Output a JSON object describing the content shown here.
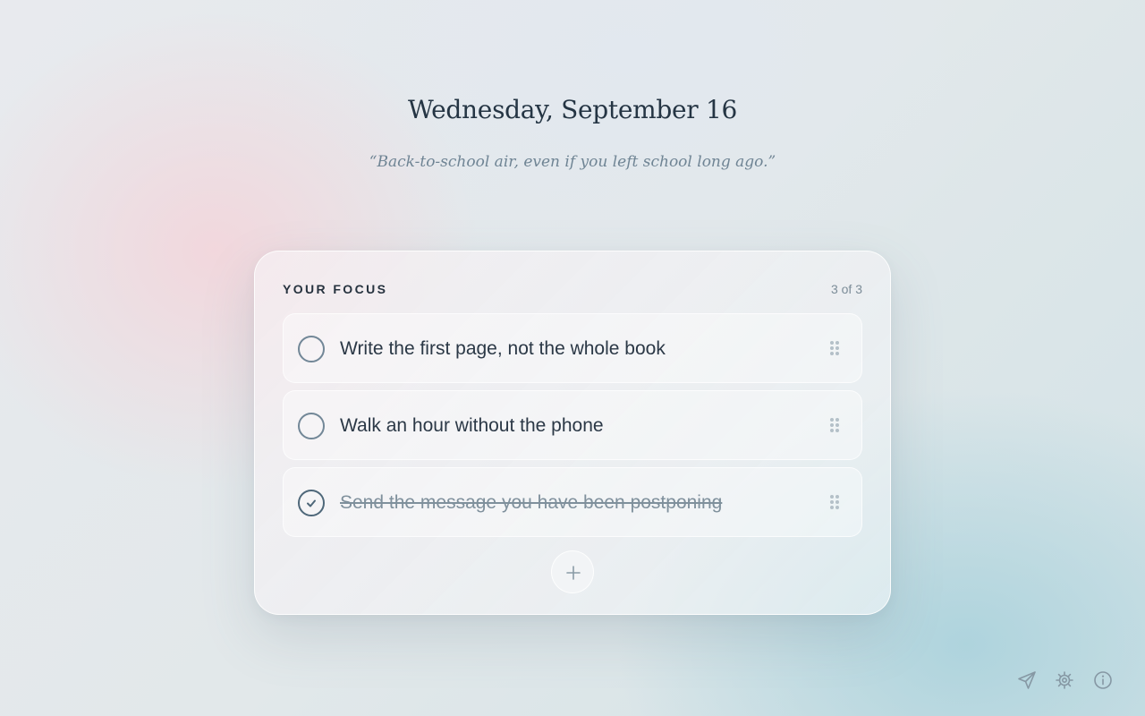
{
  "header": {
    "date": "Wednesday, September 16",
    "quote": "“Back-to-school air, even if you left school long ago.”"
  },
  "focus": {
    "title": "YOUR FOCUS",
    "count": "3 of 3",
    "tasks": [
      {
        "text": "Write the first page, not the whole book",
        "done": false
      },
      {
        "text": "Walk an hour without the phone",
        "done": false
      },
      {
        "text": "Send the message you have been postponing",
        "done": true
      }
    ],
    "add_icon": "plus-icon"
  },
  "toolbar": {
    "icons": [
      "send-icon",
      "gear-icon",
      "info-icon"
    ]
  },
  "colors": {
    "text_primary": "#253544",
    "text_muted": "#6f8494",
    "check_border": "#728797"
  }
}
